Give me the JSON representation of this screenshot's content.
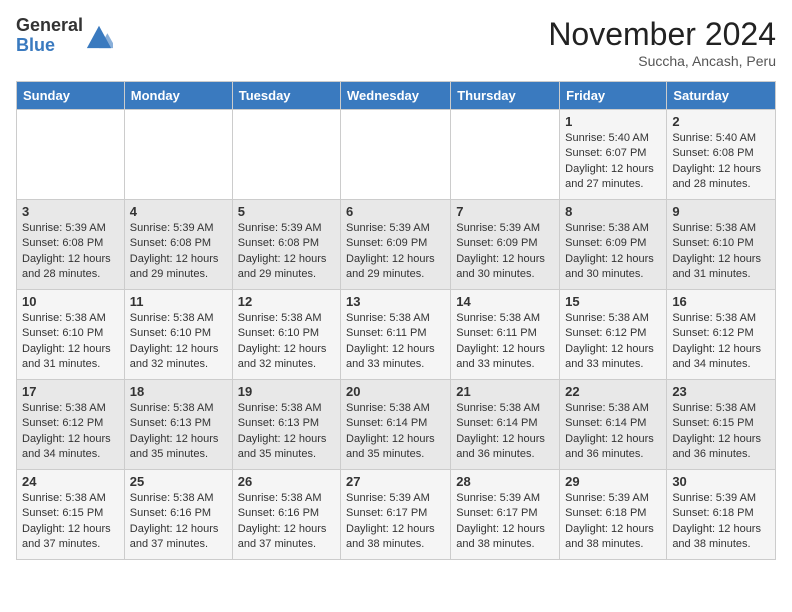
{
  "logo": {
    "general": "General",
    "blue": "Blue"
  },
  "header": {
    "month": "November 2024",
    "location": "Succha, Ancash, Peru"
  },
  "days_of_week": [
    "Sunday",
    "Monday",
    "Tuesday",
    "Wednesday",
    "Thursday",
    "Friday",
    "Saturday"
  ],
  "weeks": [
    [
      {
        "day": "",
        "info": ""
      },
      {
        "day": "",
        "info": ""
      },
      {
        "day": "",
        "info": ""
      },
      {
        "day": "",
        "info": ""
      },
      {
        "day": "",
        "info": ""
      },
      {
        "day": "1",
        "info": "Sunrise: 5:40 AM\nSunset: 6:07 PM\nDaylight: 12 hours and 27 minutes."
      },
      {
        "day": "2",
        "info": "Sunrise: 5:40 AM\nSunset: 6:08 PM\nDaylight: 12 hours and 28 minutes."
      }
    ],
    [
      {
        "day": "3",
        "info": "Sunrise: 5:39 AM\nSunset: 6:08 PM\nDaylight: 12 hours and 28 minutes."
      },
      {
        "day": "4",
        "info": "Sunrise: 5:39 AM\nSunset: 6:08 PM\nDaylight: 12 hours and 29 minutes."
      },
      {
        "day": "5",
        "info": "Sunrise: 5:39 AM\nSunset: 6:08 PM\nDaylight: 12 hours and 29 minutes."
      },
      {
        "day": "6",
        "info": "Sunrise: 5:39 AM\nSunset: 6:09 PM\nDaylight: 12 hours and 29 minutes."
      },
      {
        "day": "7",
        "info": "Sunrise: 5:39 AM\nSunset: 6:09 PM\nDaylight: 12 hours and 30 minutes."
      },
      {
        "day": "8",
        "info": "Sunrise: 5:38 AM\nSunset: 6:09 PM\nDaylight: 12 hours and 30 minutes."
      },
      {
        "day": "9",
        "info": "Sunrise: 5:38 AM\nSunset: 6:10 PM\nDaylight: 12 hours and 31 minutes."
      }
    ],
    [
      {
        "day": "10",
        "info": "Sunrise: 5:38 AM\nSunset: 6:10 PM\nDaylight: 12 hours and 31 minutes."
      },
      {
        "day": "11",
        "info": "Sunrise: 5:38 AM\nSunset: 6:10 PM\nDaylight: 12 hours and 32 minutes."
      },
      {
        "day": "12",
        "info": "Sunrise: 5:38 AM\nSunset: 6:10 PM\nDaylight: 12 hours and 32 minutes."
      },
      {
        "day": "13",
        "info": "Sunrise: 5:38 AM\nSunset: 6:11 PM\nDaylight: 12 hours and 33 minutes."
      },
      {
        "day": "14",
        "info": "Sunrise: 5:38 AM\nSunset: 6:11 PM\nDaylight: 12 hours and 33 minutes."
      },
      {
        "day": "15",
        "info": "Sunrise: 5:38 AM\nSunset: 6:12 PM\nDaylight: 12 hours and 33 minutes."
      },
      {
        "day": "16",
        "info": "Sunrise: 5:38 AM\nSunset: 6:12 PM\nDaylight: 12 hours and 34 minutes."
      }
    ],
    [
      {
        "day": "17",
        "info": "Sunrise: 5:38 AM\nSunset: 6:12 PM\nDaylight: 12 hours and 34 minutes."
      },
      {
        "day": "18",
        "info": "Sunrise: 5:38 AM\nSunset: 6:13 PM\nDaylight: 12 hours and 35 minutes."
      },
      {
        "day": "19",
        "info": "Sunrise: 5:38 AM\nSunset: 6:13 PM\nDaylight: 12 hours and 35 minutes."
      },
      {
        "day": "20",
        "info": "Sunrise: 5:38 AM\nSunset: 6:14 PM\nDaylight: 12 hours and 35 minutes."
      },
      {
        "day": "21",
        "info": "Sunrise: 5:38 AM\nSunset: 6:14 PM\nDaylight: 12 hours and 36 minutes."
      },
      {
        "day": "22",
        "info": "Sunrise: 5:38 AM\nSunset: 6:14 PM\nDaylight: 12 hours and 36 minutes."
      },
      {
        "day": "23",
        "info": "Sunrise: 5:38 AM\nSunset: 6:15 PM\nDaylight: 12 hours and 36 minutes."
      }
    ],
    [
      {
        "day": "24",
        "info": "Sunrise: 5:38 AM\nSunset: 6:15 PM\nDaylight: 12 hours and 37 minutes."
      },
      {
        "day": "25",
        "info": "Sunrise: 5:38 AM\nSunset: 6:16 PM\nDaylight: 12 hours and 37 minutes."
      },
      {
        "day": "26",
        "info": "Sunrise: 5:38 AM\nSunset: 6:16 PM\nDaylight: 12 hours and 37 minutes."
      },
      {
        "day": "27",
        "info": "Sunrise: 5:39 AM\nSunset: 6:17 PM\nDaylight: 12 hours and 38 minutes."
      },
      {
        "day": "28",
        "info": "Sunrise: 5:39 AM\nSunset: 6:17 PM\nDaylight: 12 hours and 38 minutes."
      },
      {
        "day": "29",
        "info": "Sunrise: 5:39 AM\nSunset: 6:18 PM\nDaylight: 12 hours and 38 minutes."
      },
      {
        "day": "30",
        "info": "Sunrise: 5:39 AM\nSunset: 6:18 PM\nDaylight: 12 hours and 38 minutes."
      }
    ]
  ]
}
